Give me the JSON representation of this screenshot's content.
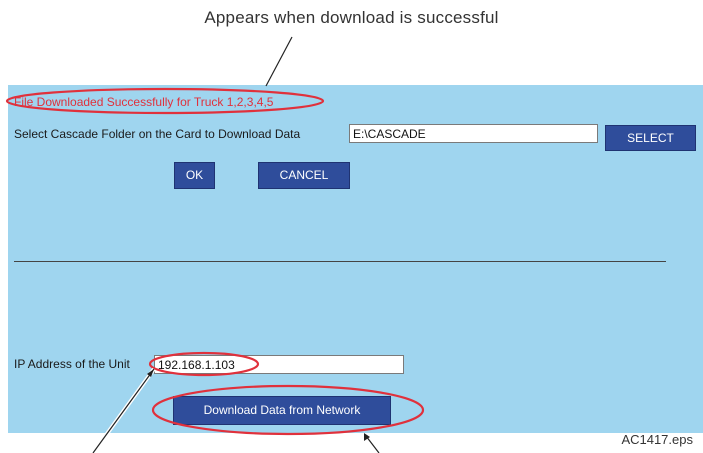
{
  "annotations": {
    "top_caption": "Appears when download is successful",
    "file_id": "AC1417.eps"
  },
  "status_message": "File Downloaded Successfully for Truck 1,2,3,4,5",
  "cascade": {
    "label": "Select Cascade Folder on the Card to Download Data",
    "path_value": "E:\\CASCADE",
    "select_label": "SELECT"
  },
  "dialog": {
    "ok_label": "OK",
    "cancel_label": "CANCEL"
  },
  "network": {
    "ip_label": "IP Address of the Unit",
    "ip_value": "192.168.1.103",
    "download_label": "Download Data from Network"
  },
  "colors": {
    "panel": "#9fd5ef",
    "button": "#2f4d9b",
    "highlight": "#e0313c"
  }
}
